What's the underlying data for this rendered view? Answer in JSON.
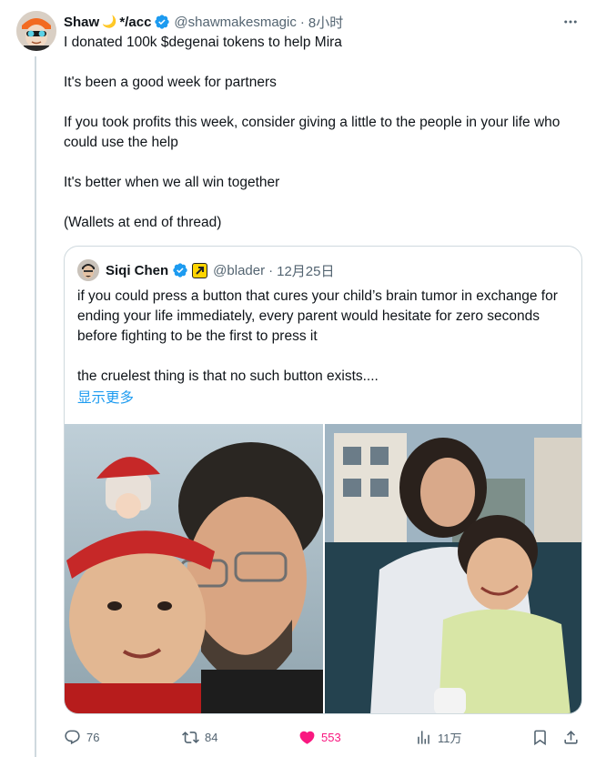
{
  "tweet": {
    "author_name": "Shaw",
    "author_name_suffix": "*/acc",
    "handle": "@shawmakesmagic",
    "separator": "·",
    "time": "8小时",
    "paragraphs": [
      "I donated 100k $degenai tokens to help Mira",
      "It's been a good week for partners",
      "If you took profits this week, consider giving a little to the people in your life who could use the help",
      "It's better when we all win together",
      "(Wallets at end of thread)"
    ]
  },
  "quote": {
    "author_name": "Siqi Chen",
    "handle": "@blader",
    "separator": "·",
    "date": "12月25日",
    "paragraphs": [
      "if you could press a button that cures your child’s brain tumor in exchange for ending your life immediately, every parent would hesitate for zero seconds before fighting to be the first to press it",
      "the cruelest thing is that no such button exists...."
    ],
    "show_more": "显示更多"
  },
  "actions": {
    "replies": "76",
    "reposts": "84",
    "likes": "553",
    "views": "11万"
  },
  "colors": {
    "accent": "#1d9bf0",
    "like": "#f91880",
    "muted": "#536471",
    "border": "#cfd9de"
  },
  "icons": [
    "more-icon",
    "verified-badge-icon",
    "reply-icon",
    "repost-icon",
    "like-icon",
    "views-icon",
    "bookmark-icon",
    "share-icon"
  ]
}
